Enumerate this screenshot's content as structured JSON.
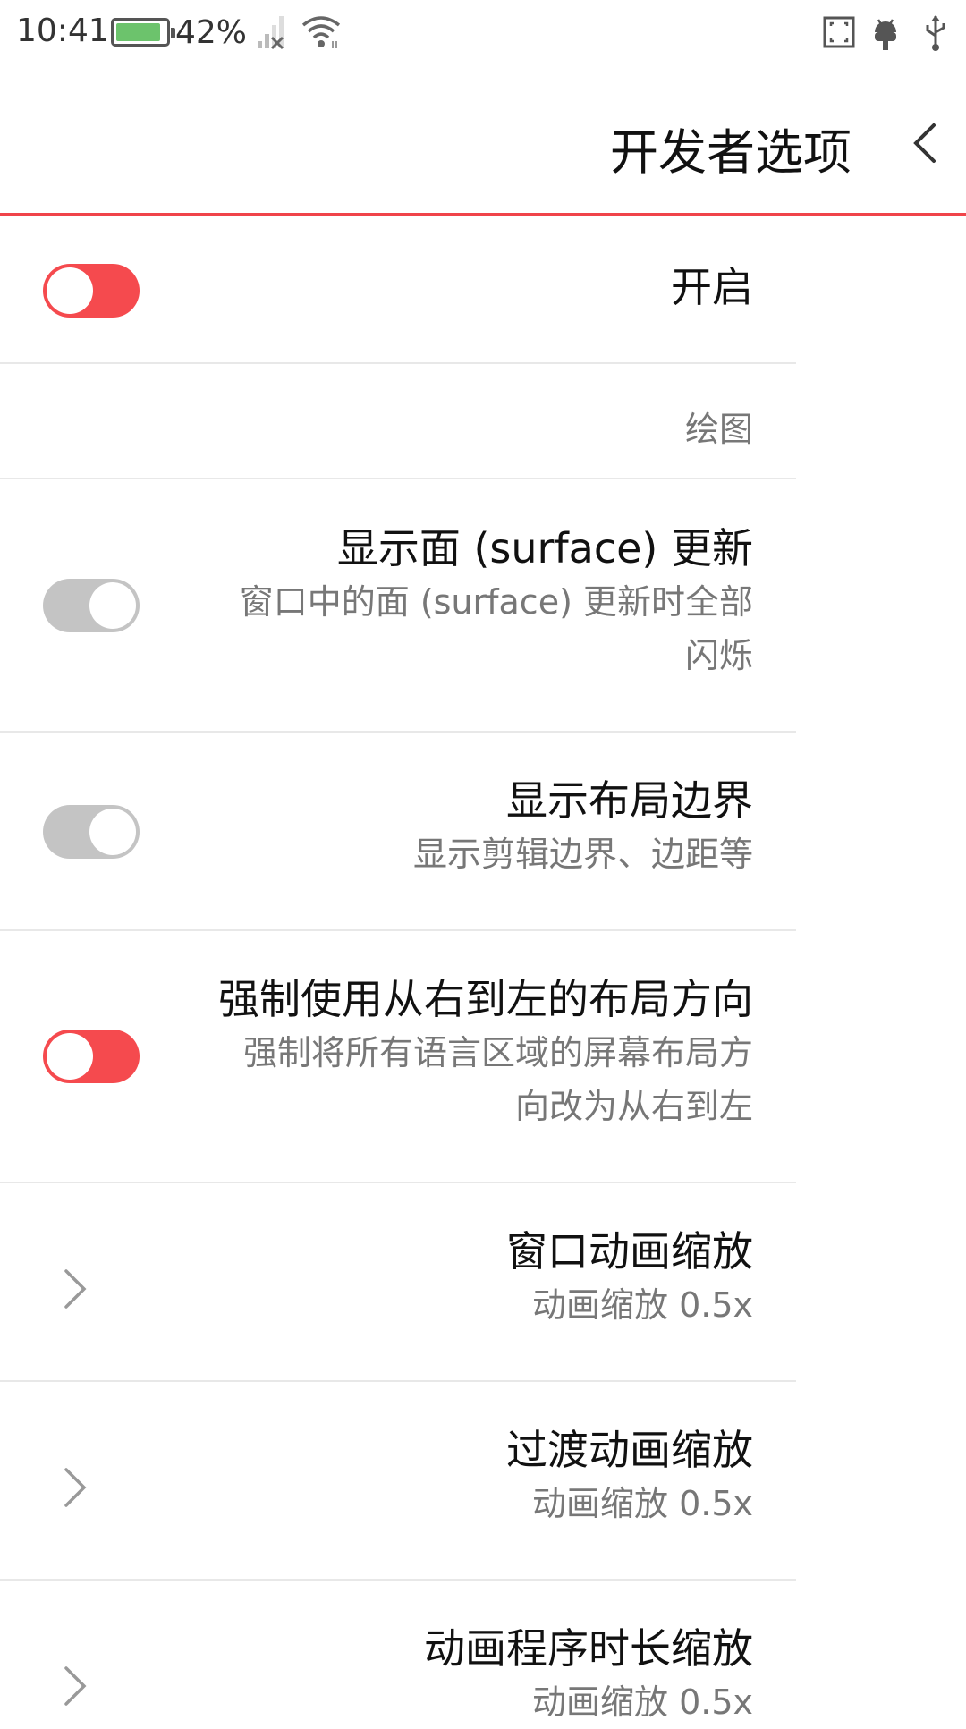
{
  "status_bar": {
    "time": "10:41",
    "battery_percent": "42%",
    "battery_level": 0.9,
    "icons": [
      "battery-icon",
      "no-signal-icon",
      "wifi-icon",
      "screenshot-icon",
      "android-debug-icon",
      "usb-icon"
    ]
  },
  "header": {
    "title": "开发者选项",
    "back_icon": "chevron-left-icon"
  },
  "colors": {
    "accent": "#f54a4e",
    "header_divider": "#f0444a",
    "toggle_off": "#c4c4c4"
  },
  "list": {
    "master_toggle": {
      "label": "开启",
      "state": "on"
    },
    "category": "绘图",
    "surface_updates": {
      "title": "显示面 (surface) 更新",
      "subtitle_line1": "窗口中的面 (surface) 更新时全部",
      "subtitle_line2": "闪烁",
      "state": "off"
    },
    "layout_bounds": {
      "title": "显示布局边界",
      "subtitle": "显示剪辑边界、边距等",
      "state": "off"
    },
    "force_rtl": {
      "title": "强制使用从右到左的布局方向",
      "subtitle_line1": "强制将所有语言区域的屏幕布局方",
      "subtitle_line2": "向改为从右到左",
      "state": "on"
    },
    "window_anim": {
      "title": "窗口动画缩放",
      "subtitle": "动画缩放 0.5x"
    },
    "transition_anim": {
      "title": "过渡动画缩放",
      "subtitle": "动画缩放 0.5x"
    },
    "animator_duration": {
      "title": "动画程序时长缩放",
      "subtitle": "动画缩放 0.5x"
    }
  }
}
